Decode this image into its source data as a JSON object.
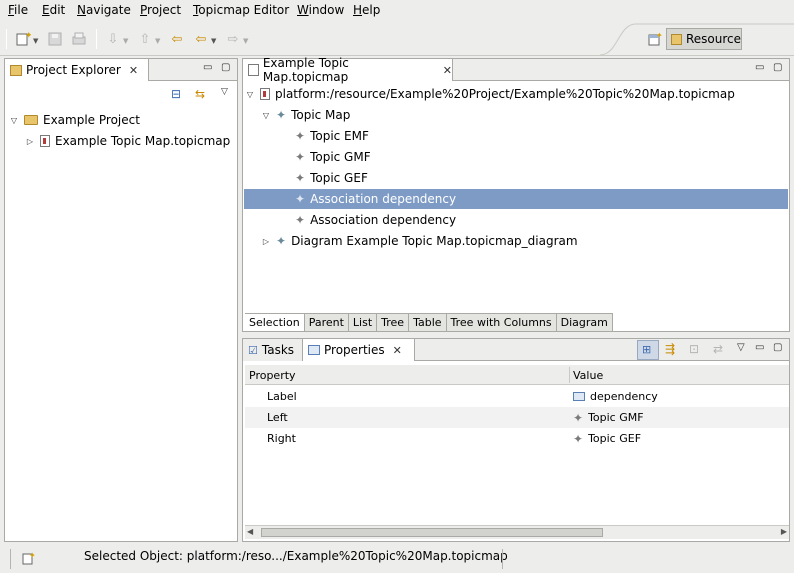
{
  "menu": {
    "items": [
      {
        "label": "File",
        "underline": "F",
        "rest": "ile"
      },
      {
        "label": "Edit",
        "underline": "E",
        "rest": "dit"
      },
      {
        "label": "Navigate",
        "underline": "N",
        "rest": "avigate"
      },
      {
        "label": "Project",
        "underline": "P",
        "rest": "roject"
      },
      {
        "label": "Topicmap Editor",
        "underline": "T",
        "rest": "opicmap Editor"
      },
      {
        "label": "Window",
        "underline": "W",
        "rest": "indow"
      },
      {
        "label": "Help",
        "underline": "H",
        "rest": "elp"
      }
    ]
  },
  "toolbar": {
    "perspective_label": "Resource"
  },
  "project_explorer": {
    "tab_label": "Project Explorer",
    "tree": {
      "project": "Example Project",
      "file": "Example Topic Map.topicmap"
    }
  },
  "editor": {
    "tab_label": "Example Topic Map.topicmap",
    "root": "platform:/resource/Example%20Project/Example%20Topic%20Map.topicmap",
    "topic_map": "Topic Map",
    "children": [
      "Topic EMF",
      "Topic GMF",
      "Topic GEF",
      "Association dependency",
      "Association dependency"
    ],
    "selected_index": 3,
    "diagram": "Diagram Example Topic Map.topicmap_diagram",
    "bottom_tabs": [
      "Selection",
      "Parent",
      "List",
      "Tree",
      "Table",
      "Tree with Columns",
      "Diagram"
    ],
    "active_bottom_tab": 0
  },
  "bottom_panel": {
    "tabs": {
      "tasks": "Tasks",
      "properties": "Properties"
    },
    "columns": {
      "property": "Property",
      "value": "Value"
    },
    "rows": [
      {
        "property": "Label",
        "value": "dependency",
        "icon": "label-icon"
      },
      {
        "property": "Left",
        "value": "Topic GMF",
        "icon": "topic-icon"
      },
      {
        "property": "Right",
        "value": "Topic GEF",
        "icon": "topic-icon"
      }
    ]
  },
  "status": {
    "text": "Selected Object: platform:/reso.../Example%20Topic%20Map.topicmap"
  }
}
